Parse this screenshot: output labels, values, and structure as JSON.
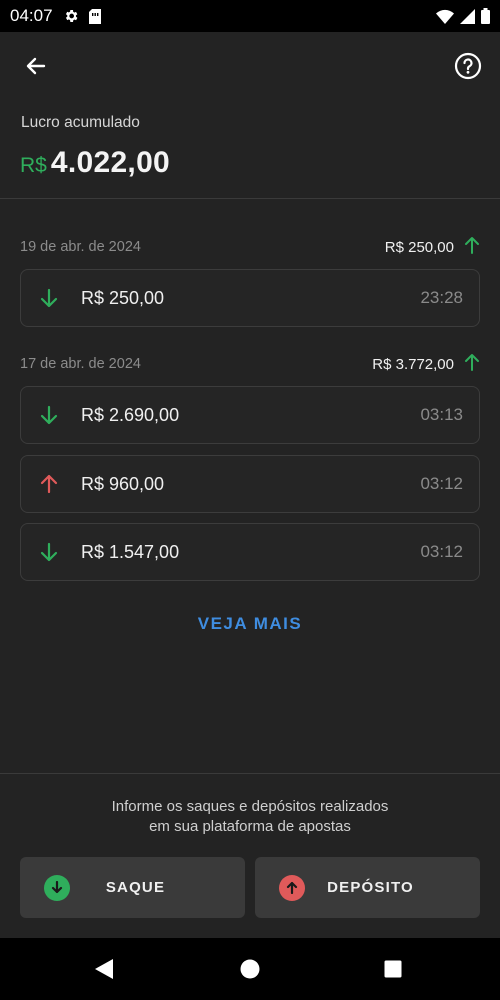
{
  "status_bar": {
    "time": "04:07",
    "icons": [
      "gear-icon",
      "sim-card-icon",
      "wifi-icon",
      "signal-icon",
      "battery-icon"
    ]
  },
  "header": {
    "back_icon": "arrow-left-icon",
    "help_icon": "question-circle-icon"
  },
  "summary": {
    "label": "Lucro acumulado",
    "currency": "R$",
    "value": "4.022,00"
  },
  "groups": [
    {
      "date": "19 de abr. de 2024",
      "total": "R$ 250,00",
      "total_direction": "up",
      "transactions": [
        {
          "amount": "R$ 250,00",
          "time": "23:28",
          "direction": "down"
        }
      ]
    },
    {
      "date": "17 de abr. de 2024",
      "total": "R$ 3.772,00",
      "total_direction": "up",
      "transactions": [
        {
          "amount": "R$ 2.690,00",
          "time": "03:13",
          "direction": "down"
        },
        {
          "amount": "R$ 960,00",
          "time": "03:12",
          "direction": "up"
        },
        {
          "amount": "R$ 1.547,00",
          "time": "03:12",
          "direction": "down"
        }
      ]
    }
  ],
  "see_more": "VEJA MAIS",
  "info": {
    "line1": "Informe os saques e depósitos realizados",
    "line2": "em sua plataforma de apostas"
  },
  "actions": {
    "withdraw_label": "SAQUE",
    "deposit_label": "DEPÓSITO"
  },
  "colors": {
    "green": "#2fae5c",
    "red": "#e05a5a",
    "link": "#3f8de0",
    "background": "#232323"
  },
  "nav": {
    "icons": [
      "back-triangle-icon",
      "home-circle-icon",
      "recents-square-icon"
    ]
  }
}
